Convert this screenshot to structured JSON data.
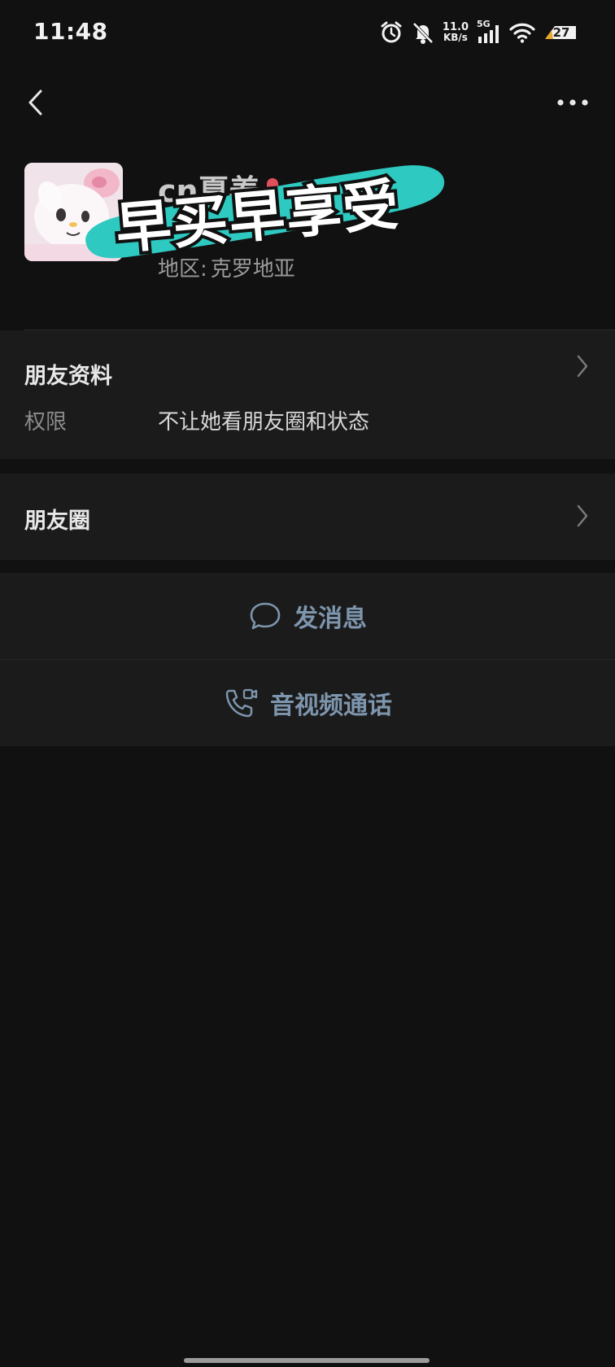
{
  "status_bar": {
    "time": "11:48",
    "net_speed_value": "11.0",
    "net_speed_unit": "KB/s",
    "network_type": "5G",
    "battery_level": "27",
    "icons": [
      "alarm-icon",
      "mute-bell-icon",
      "signal-icon",
      "wifi-icon",
      "battery-icon"
    ]
  },
  "nav": {
    "back_icon": "chevron-left-icon",
    "more_icon": "more-dots-icon"
  },
  "profile": {
    "display_name": "cn夏养",
    "region_label": "地区:",
    "region_value": "克罗地亚",
    "gender_color": "#e0505a"
  },
  "sticker": {
    "text": "早买早享受",
    "color": "#2ec9c0"
  },
  "friend_info": {
    "title": "朋友资料",
    "permission_label": "权限",
    "permission_value": "不让她看朋友圈和状态"
  },
  "moments": {
    "title": "朋友圈"
  },
  "actions": {
    "message_label": "发消息",
    "call_label": "音视频通话",
    "accent_color": "#7d95ad"
  }
}
